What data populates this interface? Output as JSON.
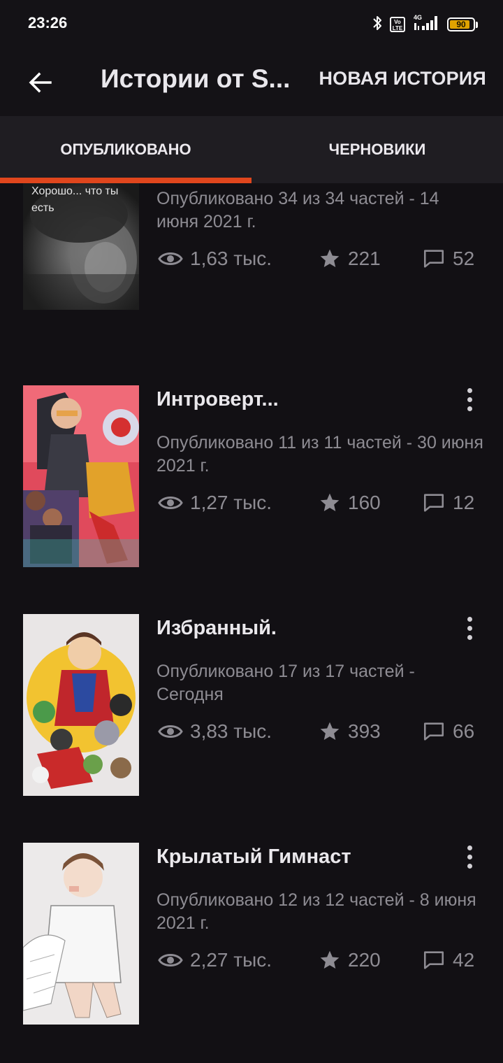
{
  "status_bar": {
    "time": "23:26",
    "battery": "90",
    "network": "4G",
    "volte": "Vo LTE",
    "accent_battery_color": "#e0a300",
    "icons": [
      "bluetooth-icon",
      "volte-icon",
      "signal-icon",
      "battery-icon"
    ]
  },
  "app_bar": {
    "back_icon": "arrow-back-icon",
    "title": "Истории от S...",
    "new_story_label": "НОВАЯ ИСТОРИЯ"
  },
  "tabs": {
    "published_label": "ОПУБЛИКОВАНО",
    "drafts_label": "ЧЕРНОВИКИ",
    "active": "published",
    "indicator_color": "#e0461d"
  },
  "stories": [
    {
      "title": "",
      "cover_text": "Хорошо... что ты есть",
      "meta": "Опубликовано 34 из 34 частей - 14 июня 2021 г.",
      "reads": "1,63 тыс.",
      "votes": "221",
      "comments": "52"
    },
    {
      "title": "Интроверт...",
      "meta": "Опубликовано 11 из 11 частей - 30 июня 2021 г.",
      "reads": "1,27 тыс.",
      "votes": "160",
      "comments": "12"
    },
    {
      "title": "Избранный.",
      "meta": "Опубликовано 17 из 17 частей - Сегодня",
      "reads": "3,83 тыс.",
      "votes": "393",
      "comments": "66"
    },
    {
      "title": "Крылатый Гимнаст",
      "meta": "Опубликовано 12 из 12 частей - 8 июня 2021 г.",
      "reads": "2,27 тыс.",
      "votes": "220",
      "comments": "42"
    }
  ]
}
